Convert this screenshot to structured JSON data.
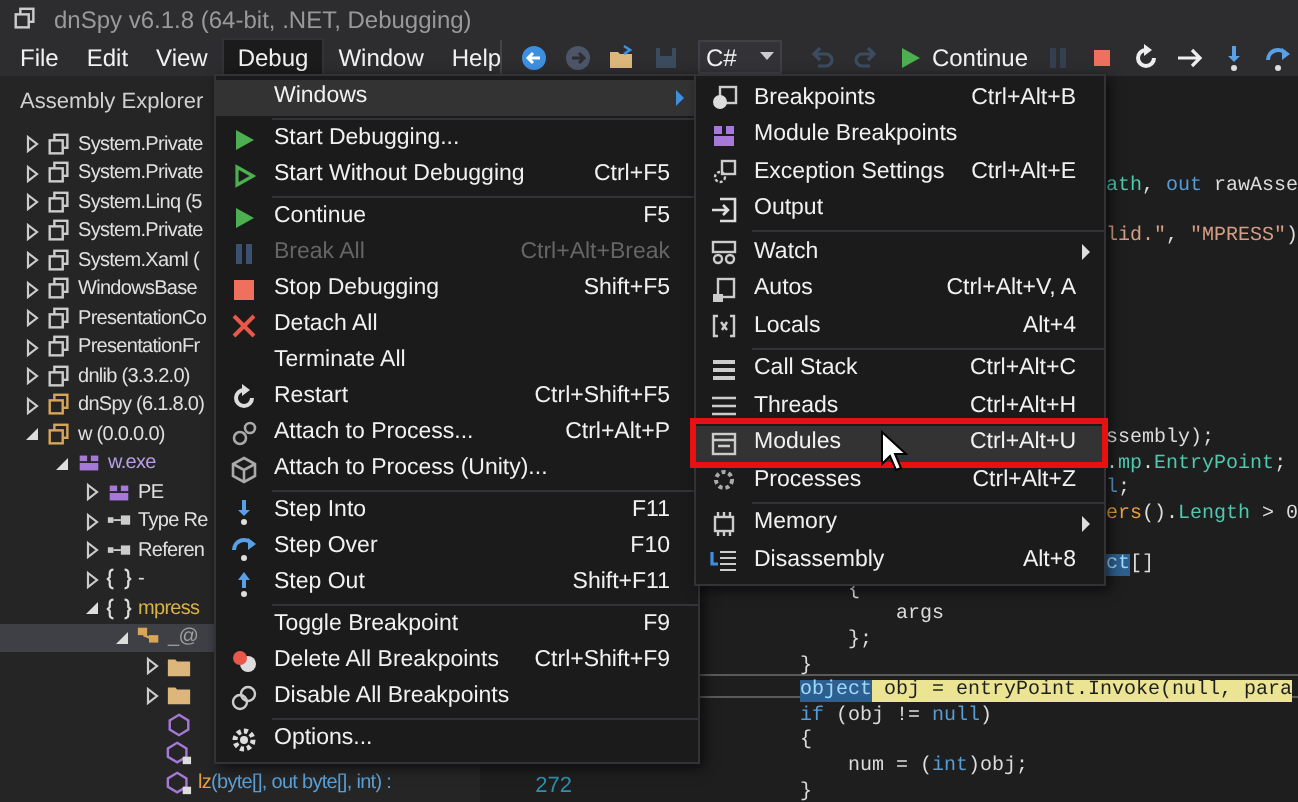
{
  "window": {
    "title": "dnSpy v6.1.8 (64-bit, .NET, Debugging)"
  },
  "menu_bar": [
    {
      "label": "File",
      "selected": false
    },
    {
      "label": "Edit",
      "selected": false
    },
    {
      "label": "View",
      "selected": false
    },
    {
      "label": "Debug",
      "selected": true
    },
    {
      "label": "Window",
      "selected": false
    },
    {
      "label": "Help",
      "selected": false
    }
  ],
  "toolbar": {
    "left": [
      {
        "kind": "back",
        "disabled": false
      },
      {
        "kind": "forward",
        "disabled": true
      },
      {
        "kind": "open",
        "disabled": false
      },
      {
        "kind": "save",
        "disabled": true
      }
    ],
    "language": {
      "value": "C#"
    },
    "right": [
      {
        "kind": "undo",
        "disabled": true
      },
      {
        "kind": "redo",
        "disabled": true
      },
      {
        "kind": "continue",
        "label": "Continue",
        "disabled": false
      },
      {
        "kind": "pause",
        "disabled": true
      },
      {
        "kind": "stop",
        "disabled": false
      },
      {
        "kind": "restart",
        "disabled": false
      },
      {
        "kind": "show-next",
        "disabled": false
      },
      {
        "kind": "step-into",
        "disabled": false
      },
      {
        "kind": "step-over",
        "disabled": false
      }
    ]
  },
  "assembly_explorer": {
    "title": "Assembly Explorer",
    "tree": [
      {
        "kind": "assembly",
        "label": "System.Private",
        "expanded": false,
        "selected": false
      },
      {
        "kind": "assembly",
        "label": "System.Private",
        "expanded": false,
        "selected": false
      },
      {
        "kind": "assembly",
        "label": "System.Linq (5",
        "expanded": false,
        "selected": false
      },
      {
        "kind": "assembly",
        "label": "System.Private",
        "expanded": false,
        "selected": false
      },
      {
        "kind": "assembly",
        "label": "System.Xaml (",
        "expanded": false,
        "selected": false
      },
      {
        "kind": "assembly",
        "label": "WindowsBase",
        "expanded": false,
        "selected": false
      },
      {
        "kind": "assembly",
        "label": "PresentationCo",
        "expanded": false,
        "selected": false
      },
      {
        "kind": "assembly",
        "label": "PresentationFr",
        "expanded": false,
        "selected": false
      },
      {
        "kind": "assembly",
        "label": "dnlib (3.3.2.0)",
        "expanded": false,
        "selected": false
      },
      {
        "kind": "app-assembly",
        "label": "dnSpy (6.1.8.0)",
        "expanded": false,
        "selected": false
      },
      {
        "kind": "app-assembly",
        "label": "w (0.0.0.0)",
        "expanded": true,
        "selected": false,
        "children": [
          {
            "kind": "module",
            "label": "w.exe",
            "expanded": true,
            "selected": false,
            "children": [
              {
                "kind": "pe",
                "label": "PE",
                "expanded": false,
                "selected": false
              },
              {
                "kind": "types",
                "label": "Type Re",
                "expanded": false,
                "selected": false
              },
              {
                "kind": "references",
                "label": "Referen",
                "expanded": false,
                "selected": false
              },
              {
                "kind": "empty-namespace",
                "label": "-",
                "expanded": false,
                "selected": false
              },
              {
                "kind": "namespace",
                "label": "mpress",
                "expanded": true,
                "selected": false,
                "children": [
                  {
                    "kind": "class",
                    "label": "_@",
                    "expanded": true,
                    "selected": true,
                    "children": [
                      {
                        "kind": "folder",
                        "expanded": false,
                        "selected": false
                      },
                      {
                        "kind": "folder",
                        "expanded": false,
                        "selected": false
                      },
                      {
                        "kind": "method",
                        "selected": false
                      },
                      {
                        "kind": "private-method",
                        "selected": false
                      },
                      {
                        "kind": "private-method",
                        "name": "lz",
                        "signature": "(byte[], out byte[], int) :",
                        "selected": false
                      }
                    ]
                  }
                ]
              }
            ]
          }
        ]
      }
    ]
  },
  "debug_menu": {
    "groups": [
      [
        {
          "kind": "none",
          "label": "Windows",
          "has_submenu": true,
          "selected": true,
          "disabled": false
        }
      ],
      [
        {
          "kind": "play",
          "label": "Start Debugging...",
          "has_submenu": false,
          "selected": false,
          "disabled": false
        },
        {
          "kind": "play-outline",
          "label": "Start Without Debugging",
          "shortcut": "Ctrl+F5",
          "has_submenu": false,
          "selected": false,
          "disabled": false
        }
      ],
      [
        {
          "kind": "play",
          "label": "Continue",
          "shortcut": "F5",
          "has_submenu": false,
          "selected": false,
          "disabled": false
        },
        {
          "kind": "pause",
          "label": "Break All",
          "shortcut": "Ctrl+Alt+Break",
          "has_submenu": false,
          "selected": false,
          "disabled": true
        },
        {
          "kind": "stop",
          "label": "Stop Debugging",
          "shortcut": "Shift+F5",
          "has_submenu": false,
          "selected": false,
          "disabled": false
        },
        {
          "kind": "cross",
          "label": "Detach All",
          "has_submenu": false,
          "selected": false,
          "disabled": false
        },
        {
          "kind": "none",
          "label": "Terminate All",
          "has_submenu": false,
          "selected": false,
          "disabled": false
        },
        {
          "kind": "restart",
          "label": "Restart",
          "shortcut": "Ctrl+Shift+F5",
          "has_submenu": false,
          "selected": false,
          "disabled": false
        },
        {
          "kind": "gears",
          "label": "Attach to Process...",
          "shortcut": "Ctrl+Alt+P",
          "has_submenu": false,
          "selected": false,
          "disabled": false
        },
        {
          "kind": "cube",
          "label": "Attach to Process (Unity)...",
          "has_submenu": false,
          "selected": false,
          "disabled": false
        }
      ],
      [
        {
          "kind": "step-into",
          "label": "Step Into",
          "shortcut": "F11",
          "has_submenu": false,
          "selected": false,
          "disabled": false
        },
        {
          "kind": "step-over",
          "label": "Step Over",
          "shortcut": "F10",
          "has_submenu": false,
          "selected": false,
          "disabled": false
        },
        {
          "kind": "step-out",
          "label": "Step Out",
          "shortcut": "Shift+F11",
          "has_submenu": false,
          "selected": false,
          "disabled": false
        }
      ],
      [
        {
          "kind": "none",
          "label": "Toggle Breakpoint",
          "shortcut": "F9",
          "has_submenu": false,
          "selected": false,
          "disabled": false
        },
        {
          "kind": "delete-breakpoints",
          "label": "Delete All Breakpoints",
          "shortcut": "Ctrl+Shift+F9",
          "has_submenu": false,
          "selected": false,
          "disabled": false
        },
        {
          "kind": "disable-breakpoints",
          "label": "Disable All Breakpoints",
          "has_submenu": false,
          "selected": false,
          "disabled": false
        }
      ],
      [
        {
          "kind": "gear",
          "label": "Options...",
          "has_submenu": false,
          "selected": false,
          "disabled": false
        }
      ]
    ]
  },
  "windows_submenu": {
    "groups": [
      [
        {
          "kind": "breakpoints",
          "label": "Breakpoints",
          "shortcut": "Ctrl+Alt+B",
          "has_submenu": false,
          "selected": false
        },
        {
          "kind": "module-breakpoints",
          "label": "Module Breakpoints",
          "has_submenu": false,
          "selected": false
        },
        {
          "kind": "exception",
          "label": "Exception Settings",
          "shortcut": "Ctrl+Alt+E",
          "has_submenu": false,
          "selected": false
        },
        {
          "kind": "output",
          "label": "Output",
          "has_submenu": false,
          "selected": false
        }
      ],
      [
        {
          "kind": "watch",
          "label": "Watch",
          "has_submenu": true,
          "selected": false
        },
        {
          "kind": "autos",
          "label": "Autos",
          "shortcut": "Ctrl+Alt+V, A",
          "has_submenu": false,
          "selected": false
        },
        {
          "kind": "locals",
          "label": "Locals",
          "shortcut": "Alt+4",
          "has_submenu": false,
          "selected": false
        }
      ],
      [
        {
          "kind": "call-stack",
          "label": "Call Stack",
          "shortcut": "Ctrl+Alt+C",
          "has_submenu": false,
          "selected": false
        },
        {
          "kind": "threads",
          "label": "Threads",
          "shortcut": "Ctrl+Alt+H",
          "has_submenu": false,
          "selected": false
        },
        {
          "kind": "modules",
          "label": "Modules",
          "shortcut": "Ctrl+Alt+U",
          "has_submenu": false,
          "selected": true
        },
        {
          "kind": "processes",
          "label": "Processes",
          "shortcut": "Ctrl+Alt+Z",
          "has_submenu": false,
          "selected": false
        }
      ],
      [
        {
          "kind": "memory",
          "label": "Memory",
          "has_submenu": true,
          "selected": false
        },
        {
          "kind": "disassembly",
          "label": "Disassembly",
          "shortcut": "Alt+8",
          "has_submenu": false,
          "selected": false
        }
      ]
    ]
  },
  "editor": {
    "lines": [
      {
        "kind": "partial",
        "tokens": [
          {
            "text": "ath",
            "kind": "member"
          },
          {
            "text": ", ",
            "kind": "plain"
          },
          {
            "text": "out",
            "kind": "keyword"
          },
          {
            "text": " rawAsse",
            "kind": "plain"
          }
        ]
      },
      {
        "kind": "hidden"
      },
      {
        "kind": "partial",
        "tokens": [
          {
            "text": "lid.\"",
            "kind": "string"
          },
          {
            "text": ", ",
            "kind": "plain"
          },
          {
            "text": "\"MPRESS\"",
            "kind": "string"
          },
          {
            "text": ")",
            "kind": "plain"
          }
        ]
      },
      {
        "kind": "hidden"
      },
      {
        "kind": "hidden"
      },
      {
        "kind": "hidden"
      },
      {
        "kind": "hidden"
      },
      {
        "kind": "hidden"
      },
      {
        "kind": "hidden"
      },
      {
        "kind": "hidden"
      },
      {
        "kind": "partial",
        "tokens": [
          {
            "text": "ssembly);",
            "kind": "plain"
          }
        ]
      },
      {
        "kind": "partial",
        "tokens": [
          {
            "text": ".",
            "kind": "plain"
          },
          {
            "text": "mp",
            "kind": "member"
          },
          {
            "text": ".",
            "kind": "plain"
          },
          {
            "text": "EntryPoint",
            "kind": "member"
          },
          {
            "text": ";",
            "kind": "plain"
          }
        ]
      },
      {
        "kind": "partial",
        "tokens": [
          {
            "text": "l",
            "kind": "keyword"
          },
          {
            "text": ";",
            "kind": "plain"
          }
        ]
      },
      {
        "kind": "partial",
        "tokens": [
          {
            "text": "ers",
            "kind": "method"
          },
          {
            "text": "().",
            "kind": "plain"
          },
          {
            "text": "Length",
            "kind": "member"
          },
          {
            "text": " > 0",
            "kind": "plain"
          }
        ]
      },
      {
        "kind": "hidden"
      },
      {
        "kind": "partial",
        "tokens": [
          {
            "text": "ct",
            "kind": "reference"
          },
          {
            "text": "[]",
            "kind": "plain"
          }
        ]
      },
      {
        "kind": "full",
        "tokens": [
          {
            "text": "    {",
            "kind": "plain"
          }
        ]
      },
      {
        "kind": "full",
        "tokens": [
          {
            "text": "        args",
            "kind": "plain"
          }
        ]
      },
      {
        "kind": "full",
        "tokens": [
          {
            "text": "    };",
            "kind": "plain"
          }
        ]
      },
      {
        "kind": "full",
        "tokens": [
          {
            "text": "}",
            "kind": "plain"
          }
        ]
      },
      {
        "kind": "current",
        "tokens": [
          {
            "text": "object",
            "kind": "reference"
          },
          {
            "text": " obj = entryPoint.Invoke(null, para",
            "kind": "current"
          }
        ]
      },
      {
        "kind": "full",
        "tokens": [
          {
            "text": "if",
            "kind": "keyword"
          },
          {
            "text": " (obj != ",
            "kind": "plain"
          },
          {
            "text": "null",
            "kind": "keyword"
          },
          {
            "text": ")",
            "kind": "plain"
          }
        ]
      },
      {
        "kind": "full",
        "tokens": [
          {
            "text": "{",
            "kind": "plain"
          }
        ]
      },
      {
        "kind": "full",
        "tokens": [
          {
            "text": "    num = (",
            "kind": "plain"
          },
          {
            "text": "int",
            "kind": "keyword"
          },
          {
            "text": ")obj;",
            "kind": "plain"
          }
        ]
      },
      {
        "kind": "full",
        "line_number": "272",
        "tokens": [
          {
            "text": "}",
            "kind": "plain"
          }
        ]
      }
    ]
  }
}
